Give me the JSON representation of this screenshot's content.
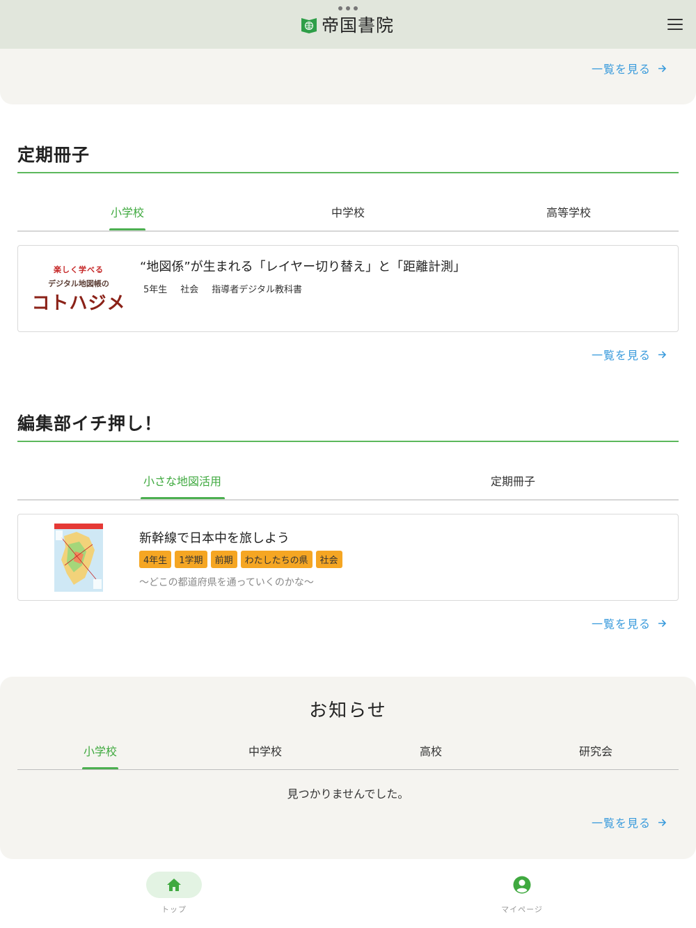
{
  "header": {
    "logo_text": "帝国書院"
  },
  "common": {
    "more_label": "一覧を見る"
  },
  "teiki": {
    "title": "定期冊子",
    "tabs": [
      "小学校",
      "中学校",
      "高等学校"
    ],
    "card": {
      "image_lines": [
        "楽しく学べる",
        "デジタル地図帳の",
        "コトハジメ"
      ],
      "title": "“地図係”が生まれる「レイヤー切り替え」と「距離計測」",
      "meta": [
        "5年生",
        "社会",
        "指導者デジタル教科書"
      ]
    }
  },
  "osusume": {
    "title": "編集部イチ押し！",
    "tabs": [
      "小さな地図活用",
      "定期冊子"
    ],
    "card": {
      "title": "新幹線で日本中を旅しよう",
      "tags": [
        "4年生",
        "1学期",
        "前期",
        "わたしたちの県",
        "社会"
      ],
      "subtitle": "〜どこの都道府県を通っていくのかな〜"
    }
  },
  "news": {
    "title": "お知らせ",
    "tabs": [
      "小学校",
      "中学校",
      "高校",
      "研究会"
    ],
    "empty": "見つかりませんでした。"
  },
  "bottom_nav": {
    "items": [
      {
        "label": "トップ",
        "icon": "home-icon"
      },
      {
        "label": "マイページ",
        "icon": "account-circle-icon"
      }
    ]
  },
  "colors": {
    "accent_green": "#4caf50",
    "link_blue": "#3a9bdc",
    "tag_orange": "#f5a623",
    "header_bg": "#e1e6dc"
  }
}
